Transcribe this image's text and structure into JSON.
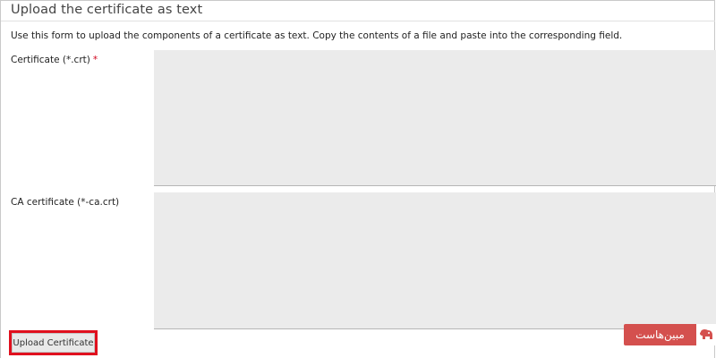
{
  "form": {
    "title": "Upload the certificate as text",
    "description": "Use this form to upload the components of a certificate as text. Copy the contents of a file and paste into the corresponding field.",
    "fields": [
      {
        "label": "Certificate (*.crt)",
        "required_mark": "*",
        "value": ""
      },
      {
        "label": "CA certificate (*-ca.crt)",
        "value": ""
      }
    ],
    "submit_label": "Upload Certificate"
  },
  "watermark": {
    "text": "مبین‌هاست",
    "icon": "elephant-logo-icon"
  },
  "colors": {
    "highlight": "#e0101e",
    "watermark_bg": "#d4504e",
    "field_bg": "#ebebeb"
  }
}
